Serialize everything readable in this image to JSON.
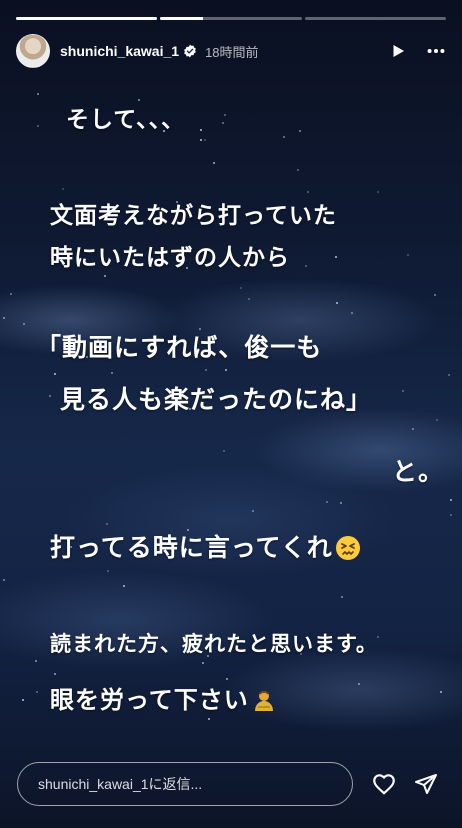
{
  "progress": {
    "segments": 3,
    "current_index": 1,
    "current_fraction": 0.3
  },
  "header": {
    "username": "shunichi_kawai_1",
    "verified": true,
    "time": "18時間前",
    "play_icon": "play-icon",
    "more_icon": "more-icon"
  },
  "story": {
    "line1": "そして、、、",
    "line2": "文面考えながら打っていた",
    "line3": "時にいたはずの人から",
    "line4": "「動画にすれば、俊一も",
    "line5": "見る人も楽だったのにね」",
    "line6": "と。",
    "line7": "打ってる時に言ってくれ",
    "line8": "読まれた方、疲れたと思います。",
    "line9": "眼を労って下さい",
    "emoji1": "confounded-face",
    "emoji2": "bowing-person"
  },
  "footer": {
    "reply_placeholder": "shunichi_kawai_1に返信...",
    "like_icon": "heart-icon",
    "share_icon": "send-icon"
  }
}
